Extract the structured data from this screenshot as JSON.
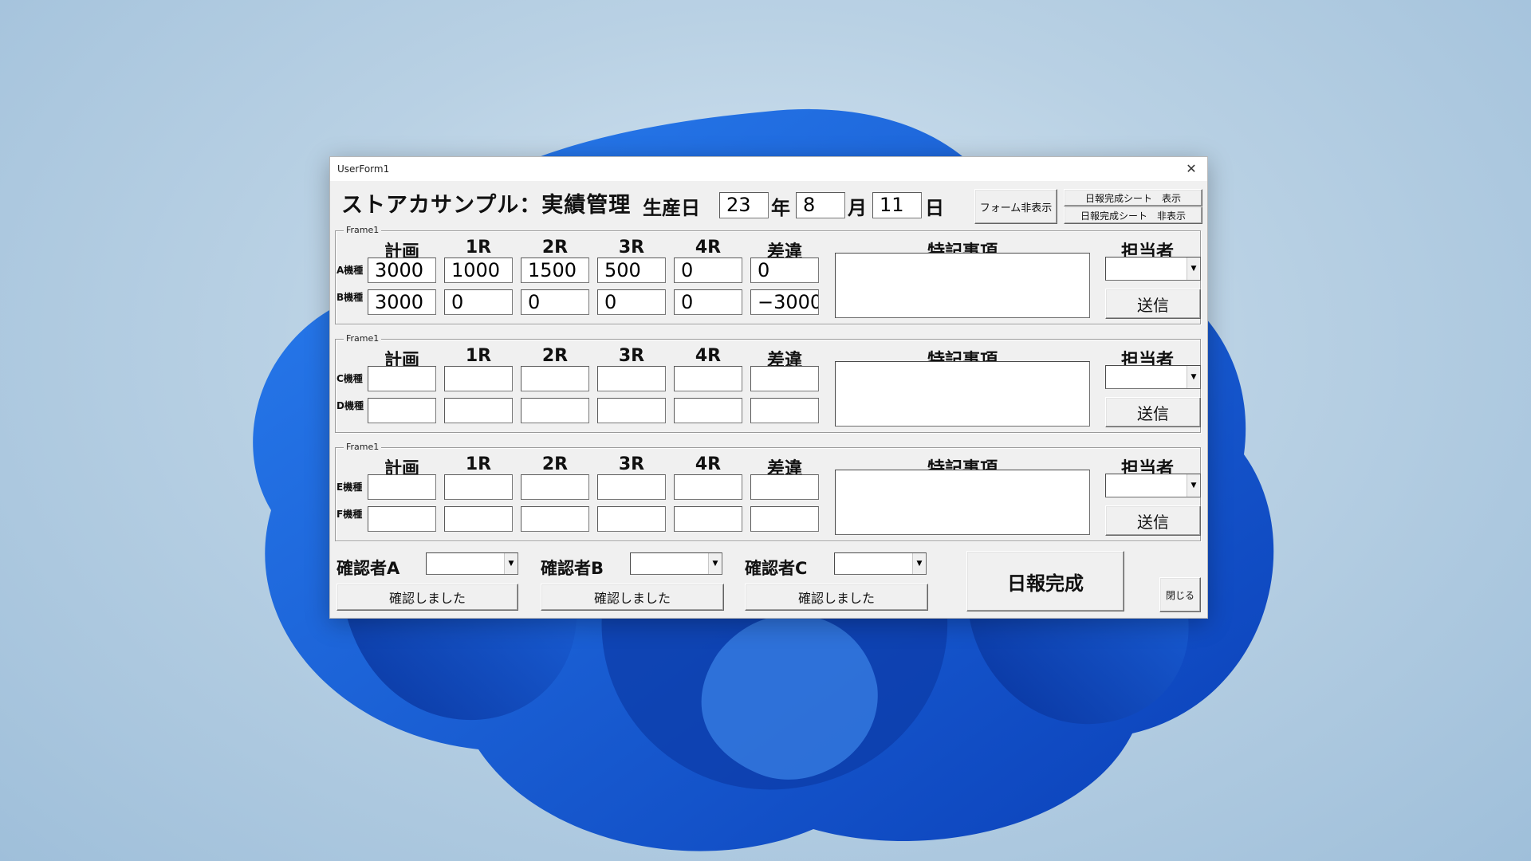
{
  "window": {
    "title": "UserForm1",
    "close_icon": "close-icon"
  },
  "header": {
    "app_title": "ストアカサンプル：実績管理",
    "date_label": "生産日",
    "year_value": "23",
    "year_label": "年",
    "month_value": "8",
    "month_label": "月",
    "day_value": "11",
    "day_label": "日",
    "hide_form_button": "フォーム非表示",
    "show_sheet_button": "日報完成シート　表示",
    "hide_sheet_button": "日報完成シート　非表示"
  },
  "columns": [
    "計画",
    "1R",
    "2R",
    "3R",
    "4R",
    "差違"
  ],
  "memo_header": "特記事項",
  "person_header": "担当者",
  "send_label": "送信",
  "frames": [
    {
      "legend": "Frame1",
      "rows": [
        {
          "label": "A機種",
          "values": [
            "3000",
            "1000",
            "1500",
            "500",
            "0",
            "0"
          ]
        },
        {
          "label": "B機種",
          "values": [
            "3000",
            "0",
            "0",
            "0",
            "0",
            "−3000"
          ]
        }
      ]
    },
    {
      "legend": "Frame1",
      "rows": [
        {
          "label": "C機種",
          "values": [
            "",
            "",
            "",
            "",
            "",
            ""
          ]
        },
        {
          "label": "D機種",
          "values": [
            "",
            "",
            "",
            "",
            "",
            ""
          ]
        }
      ]
    },
    {
      "legend": "Frame1",
      "rows": [
        {
          "label": "E機種",
          "values": [
            "",
            "",
            "",
            "",
            "",
            ""
          ]
        },
        {
          "label": "F機種",
          "values": [
            "",
            "",
            "",
            "",
            "",
            ""
          ]
        }
      ]
    }
  ],
  "confirmers": [
    {
      "label": "確認者A",
      "button": "確認しました"
    },
    {
      "label": "確認者B",
      "button": "確認しました"
    },
    {
      "label": "確認者C",
      "button": "確認しました"
    }
  ],
  "complete_button": "日報完成",
  "close_button": "閉じる",
  "icons": {
    "dropdown": "chevron-down-icon"
  }
}
